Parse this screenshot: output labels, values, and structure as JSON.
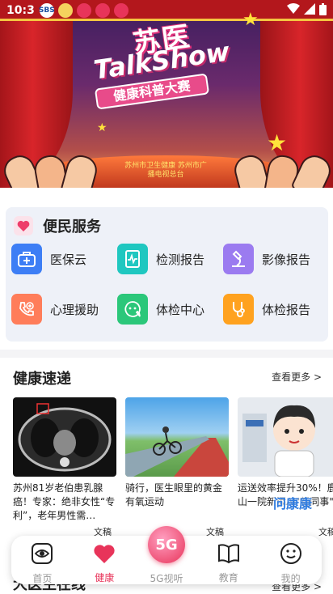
{
  "status_bar": {
    "time": "10:3",
    "app_badges": [
      "SBS",
      "",
      "",
      "",
      ""
    ]
  },
  "banner": {
    "title": "苏医",
    "show_title": "TalkShow",
    "subtitle": "健康科普大赛",
    "org": "苏州市卫生健康 苏州市广播电视总台"
  },
  "service": {
    "title": "便民服务",
    "items": [
      {
        "label": "医保云",
        "color": "#3d7ef5",
        "icon": "medical-kit-icon"
      },
      {
        "label": "检测报告",
        "color": "#1fc7c0",
        "icon": "pulse-report-icon"
      },
      {
        "label": "影像报告",
        "color": "#9b7bf0",
        "icon": "microscope-icon"
      },
      {
        "label": "心理援助",
        "color": "#ff7d5a",
        "icon": "phone-heart-icon"
      },
      {
        "label": "体检中心",
        "color": "#2bc77a",
        "icon": "chat-plus-icon"
      },
      {
        "label": "体检报告",
        "color": "#ffa21f",
        "icon": "stethoscope-icon"
      }
    ]
  },
  "news": {
    "title": "健康速递",
    "more": "查看更多 >",
    "cards": [
      {
        "text": "苏州81岁老伯患乳腺癌！专家：绝非女性“专利”，老年男性需…",
        "tag": "文稿"
      },
      {
        "text": "骑行，医生眼里的黄金有氧运动",
        "tag": "文稿"
      },
      {
        "text": "运送效率提升30%！鹿山一院新添AI\"新同事\"",
        "tag": "文稿",
        "watermark": "问康康"
      }
    ]
  },
  "next_section": {
    "title": "大医生在线",
    "more": "查看更多 >"
  },
  "nav": {
    "items": [
      {
        "label": "首页",
        "icon": "eye-home-icon"
      },
      {
        "label": "健康",
        "icon": "heart-icon"
      },
      {
        "label": "5G视听",
        "badge": "5G",
        "icon": "5g-icon"
      },
      {
        "label": "教育",
        "icon": "book-icon"
      },
      {
        "label": "我的",
        "icon": "smile-icon"
      }
    ],
    "active": "健康"
  }
}
